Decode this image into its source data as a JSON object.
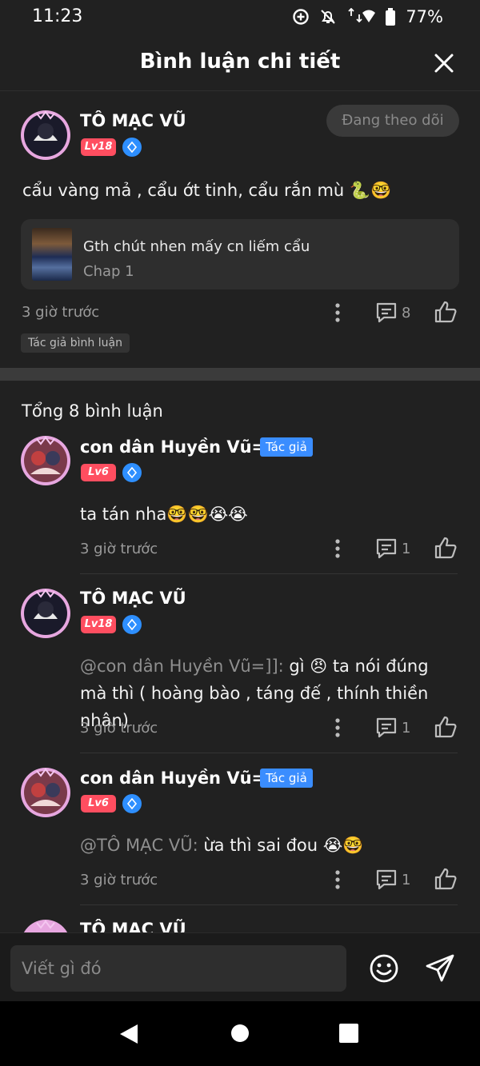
{
  "status_bar": {
    "time": "11:23",
    "battery": "77%"
  },
  "header": {
    "title": "Bình luận chi tiết"
  },
  "main_comment": {
    "username": "TÔ MẠC VŨ",
    "level": "Lv18",
    "follow_label": "Đang theo dõi",
    "text": "cẩu vàng mả , cẩu  ớt tinh, cẩu rắn mù 🐍🤓",
    "chapter": {
      "title": "Gth chút nhen mấy cn liếm cẩu",
      "sub": "Chap 1"
    },
    "time": "3 giờ trước",
    "reply_count": "8",
    "tag": "Tác giả bình luận"
  },
  "total_label": "Tổng 8 bình luận",
  "replies": [
    {
      "username": "con dân Huyền Vũ=]]",
      "level": "Lv6",
      "author_tag": "Tác giả",
      "mention": "",
      "text": "ta tán nha🤓🤓😭😭",
      "time": "3 giờ trước",
      "reply_count": "1"
    },
    {
      "username": "TÔ MẠC VŨ",
      "level": "Lv18",
      "author_tag": "",
      "mention": "@con dân Huyền Vũ=]]:",
      "text": " gì 😠 ta nói đúng mà thì ( hoàng bào , táng đế , thính thiền nhân)",
      "time": "3 giờ trước",
      "reply_count": "1"
    },
    {
      "username": "con dân Huyền Vũ=]]",
      "level": "Lv6",
      "author_tag": "Tác giả",
      "mention": "@TÔ MẠC VŨ:",
      "text": " ừa thì sai đou 😭🤓",
      "time": "3 giờ trước",
      "reply_count": "1"
    },
    {
      "username": "TÔ MẠC VŨ"
    }
  ],
  "input": {
    "placeholder": "Viết gì đó"
  },
  "colors": {
    "background": "#212121",
    "level_badge": "#ff4e60",
    "author_tag": "#3a8dff",
    "diamond": "#2e8fff"
  }
}
